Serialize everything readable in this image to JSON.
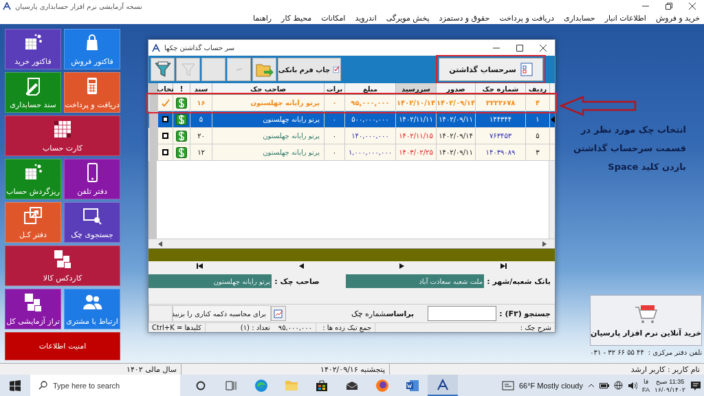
{
  "window": {
    "title": "نسخه آزمایشی نرم افزار حسابداری پارسیان"
  },
  "menu": [
    "خرید و فروش",
    "اطلاعات انبار",
    "حسابداری",
    "دریافت و پرداخت",
    "حقوق و دستمزد",
    "پخش مویرگی",
    "اندروید",
    "امکانات",
    "محیط کار",
    "راهنما"
  ],
  "tiles": [
    {
      "label": "فاکتور فروش",
      "color": "#1e7be6",
      "wide": false
    },
    {
      "label": "فاکتور خرید",
      "color": "#5a3db8",
      "wide": false
    },
    {
      "label": "دریافت و پرداخت",
      "color": "#e0562b",
      "wide": false
    },
    {
      "label": "سند حسابداری",
      "color": "#138a1b",
      "wide": false
    },
    {
      "label": "کارت حساب",
      "color": "#b31b3f",
      "wide": true
    },
    {
      "label": "دفتر تلفن",
      "color": "#8a18a6",
      "wide": false
    },
    {
      "label": "ریزگردش حساب",
      "color": "#138a1b",
      "wide": false
    },
    {
      "label": "جستجوی چک",
      "color": "#5a3db8",
      "wide": false
    },
    {
      "label": "دفتر کـل",
      "color": "#e0562b",
      "wide": false
    },
    {
      "label": "کاردکس کالا",
      "color": "#b31b3f",
      "wide": true
    },
    {
      "label": "ارتباط با مشتری",
      "color": "#1e7be6",
      "wide": false
    },
    {
      "label": "تراز آزمایشی کل",
      "color": "#8a18a6",
      "wide": false
    },
    {
      "label": "امنیت اطلاعات",
      "color": "#c10000",
      "wide": true
    }
  ],
  "dialog": {
    "title": "سر حساب گذاشتن چکها",
    "print_button": "چاپ فرم بانکی",
    "post_button": {
      "label": "سرحساب گذاشتن",
      "annotated": true
    },
    "columns": [
      {
        "label": "ردیف",
        "sorted": false
      },
      {
        "label": "شماره چک",
        "sorted": false
      },
      {
        "label": "صدور",
        "sorted": false
      },
      {
        "label": "سررسید",
        "sorted": true
      },
      {
        "label": "مبلغ",
        "sorted": false
      },
      {
        "label": "برات",
        "sorted": false
      },
      {
        "label": "صاحب چک",
        "sorted": false
      },
      {
        "label": "سند",
        "sorted": false
      },
      {
        "label": "!",
        "sorted": false
      },
      {
        "label": "تخاب",
        "sorted": false
      }
    ],
    "rows": [
      {
        "number": "۴",
        "check_no": "۳۲۳۲۶۷۸",
        "issued": "۱۴۰۲/۰۹/۱۴",
        "due": "۱۴۰۲/۱۰/۱۴",
        "amount": "۹۵,۰۰۰,۰۰۰",
        "draft": "۰",
        "owner": "پرتو رایانه چهلستون",
        "doc": "۱۶",
        "checked": true,
        "selected": false,
        "annotated": true
      },
      {
        "number": "۱",
        "check_no": "۱۴۴۳۴۴",
        "issued": "۱۴۰۲/۰۹/۱۱",
        "due": "۱۴۰۲/۱۱/۱۱",
        "amount": "۵۰۰,۰۰۰,۰۰۰",
        "draft": "۰",
        "owner": "پرتو رایانه چهلستون",
        "doc": "۵",
        "checked": false,
        "selected": true,
        "annotated": false
      },
      {
        "number": "۵",
        "check_no": "۷۶۳۴۵۳",
        "issued": "۱۴۰۲/۰۹/۱۴",
        "due": "۱۴۰۲/۱۱/۱۵",
        "amount": "۱۴۰,۰۰۰,۰۰۰",
        "draft": "۰",
        "owner": "پرتو رایانه چهلستون",
        "doc": "۲۰",
        "checked": false,
        "selected": false,
        "annotated": false
      },
      {
        "number": "۳",
        "check_no": "۱۴۰۳۹۰۸۹",
        "issued": "۱۴۰۲/۰۹/۱۱",
        "due": "۱۴۰۳/۰۲/۲۵",
        "amount": "۱,۰۰۰,۰۰۰,۰۰۰",
        "draft": "۰",
        "owner": "پرتو رایانه چهلستون",
        "doc": "۱۲",
        "checked": false,
        "selected": false,
        "annotated": false
      }
    ],
    "bank_label": "بانک شعبه/شهر :",
    "bank_value": "ملت شعبه سعادت آباد",
    "owner_label": "صاحب چک :",
    "owner_value": "پرتو رایانه چهلستون",
    "search_label": "جستجو (F۳) :",
    "search_by": "**براساس**شماره چک",
    "calc_hint": "برای محاسبه دکمه کناری را بزنید",
    "status": {
      "description": "شرح چک :",
      "total_label": "جمع تیک زده ها :",
      "total": "۹۵,۰۰۰,۰۰۰",
      "count": "تعداد : (۱)",
      "keys": "کلیدها = Ctrl+K"
    }
  },
  "annotation": "انتخاب چک مورد نظر در\nقسمت سرحساب گذاشتن\nبازدن کلید Space",
  "shop": "خرید آنلاین نرم افزار پارسیان",
  "phone_label": "تلفن دفتر مرکزی :",
  "phone": "۰۳۱ - ۳۲ ۶۶ ۵۵ ۴۴",
  "status_bar": {
    "user": "نام کاربر : کاربر ارشد",
    "date": "پنجشنبه  ۱۴۰۲/۰۹/۱۶",
    "fiscal_year": "سال مالی ۱۴۰۲"
  },
  "taskbar": {
    "search_placeholder": "Type here to search",
    "weather": "66°F Mostly cloudy",
    "time": "11:35 صبح",
    "date": "۱۶/۰۹/۱۴۰۲",
    "lang_short": "فا",
    "lang": "FA"
  }
}
